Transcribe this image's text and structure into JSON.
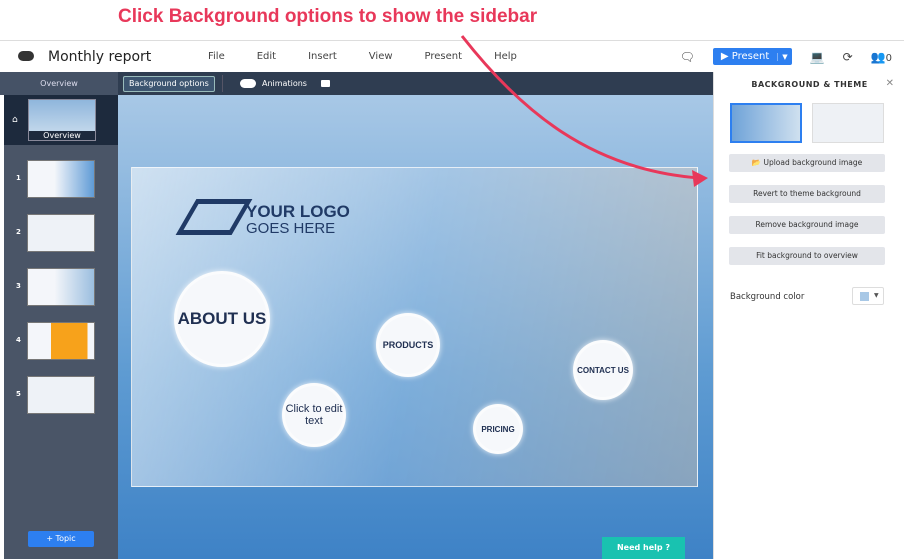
{
  "annotation": "Click Background options to show the sidebar",
  "header": {
    "title": "Monthly report",
    "menu": [
      "File",
      "Edit",
      "Insert",
      "View",
      "Present",
      "Help"
    ],
    "present_label": "Present",
    "collaborators": "0"
  },
  "toolbar": {
    "overview": "Overview",
    "background_options": "Background options",
    "animations": "Animations"
  },
  "sidebar": {
    "overview_label": "Overview",
    "slides": [
      "1",
      "2",
      "3",
      "4",
      "5"
    ],
    "topic_button": "+ Topic"
  },
  "canvas": {
    "logo_line1": "YOUR LOGO",
    "logo_line2": "GOES HERE",
    "about": "ABOUT US",
    "products": "PRODUCTS",
    "click": "Click to edit text",
    "pricing": "PRICING",
    "contact": "CONTACT US",
    "need_help": "Need help ?"
  },
  "panel": {
    "title": "BACKGROUND & THEME",
    "buttons": [
      "Upload background image",
      "Revert to theme background",
      "Remove background image",
      "Fit background to overview"
    ],
    "bg_color_label": "Background color",
    "bg_color": "#a8c8e6"
  },
  "colors": {
    "accent": "#2d7ff0",
    "annotation": "#e8385a",
    "help": "#19c2b0"
  }
}
